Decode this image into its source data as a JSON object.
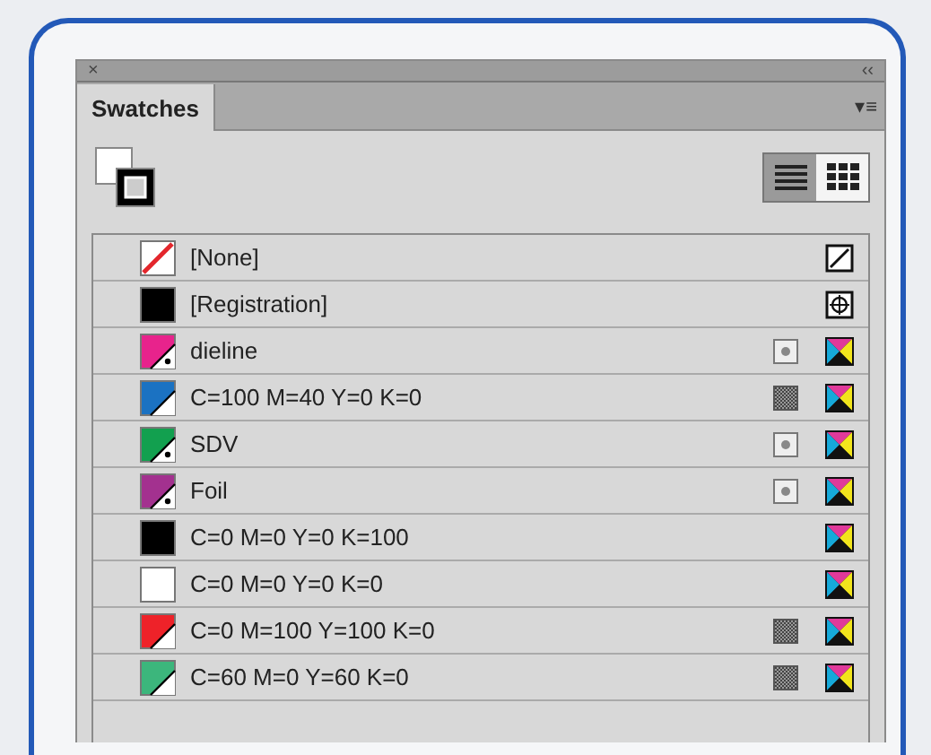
{
  "panel": {
    "close": "×",
    "collapse": "‹‹",
    "tab": "Swatches",
    "menu": "▾≡"
  },
  "view_buttons": [
    {
      "kind": "list",
      "selected": true
    },
    {
      "kind": "grid",
      "selected": false
    }
  ],
  "swatches": [
    {
      "name": "[None]",
      "kind": "none",
      "color": "#ffffff",
      "mode": {
        "kind": "none"
      }
    },
    {
      "name": "[Registration]",
      "kind": "solid",
      "color": "#000000",
      "mode": {
        "kind": "registration"
      }
    },
    {
      "name": "dieline",
      "kind": "spot",
      "color": "#e8238c",
      "type": {
        "kind": "spot"
      },
      "mode": {
        "kind": "cmyk"
      }
    },
    {
      "name": "C=100 M=40 Y=0 K=0",
      "kind": "global",
      "color": "#1b72c2",
      "type": {
        "kind": "screen"
      },
      "mode": {
        "kind": "cmyk"
      }
    },
    {
      "name": "SDV",
      "kind": "spot",
      "color": "#12a04f",
      "type": {
        "kind": "spot"
      },
      "mode": {
        "kind": "cmyk"
      }
    },
    {
      "name": "Foil",
      "kind": "spot",
      "color": "#a3318f",
      "type": {
        "kind": "spot"
      },
      "mode": {
        "kind": "cmyk"
      }
    },
    {
      "name": "C=0 M=0 Y=0 K=100",
      "kind": "solid",
      "color": "#000000",
      "mode": {
        "kind": "cmyk"
      }
    },
    {
      "name": "C=0 M=0 Y=0 K=0",
      "kind": "solid",
      "color": "#ffffff",
      "mode": {
        "kind": "cmyk"
      }
    },
    {
      "name": "C=0 M=100 Y=100 K=0",
      "kind": "global",
      "color": "#ee2229",
      "type": {
        "kind": "screen"
      },
      "mode": {
        "kind": "cmyk"
      }
    },
    {
      "name": "C=60 M=0 Y=60 K=0",
      "kind": "global",
      "color": "#3cb67c",
      "type": {
        "kind": "screen"
      },
      "mode": {
        "kind": "cmyk"
      }
    }
  ]
}
